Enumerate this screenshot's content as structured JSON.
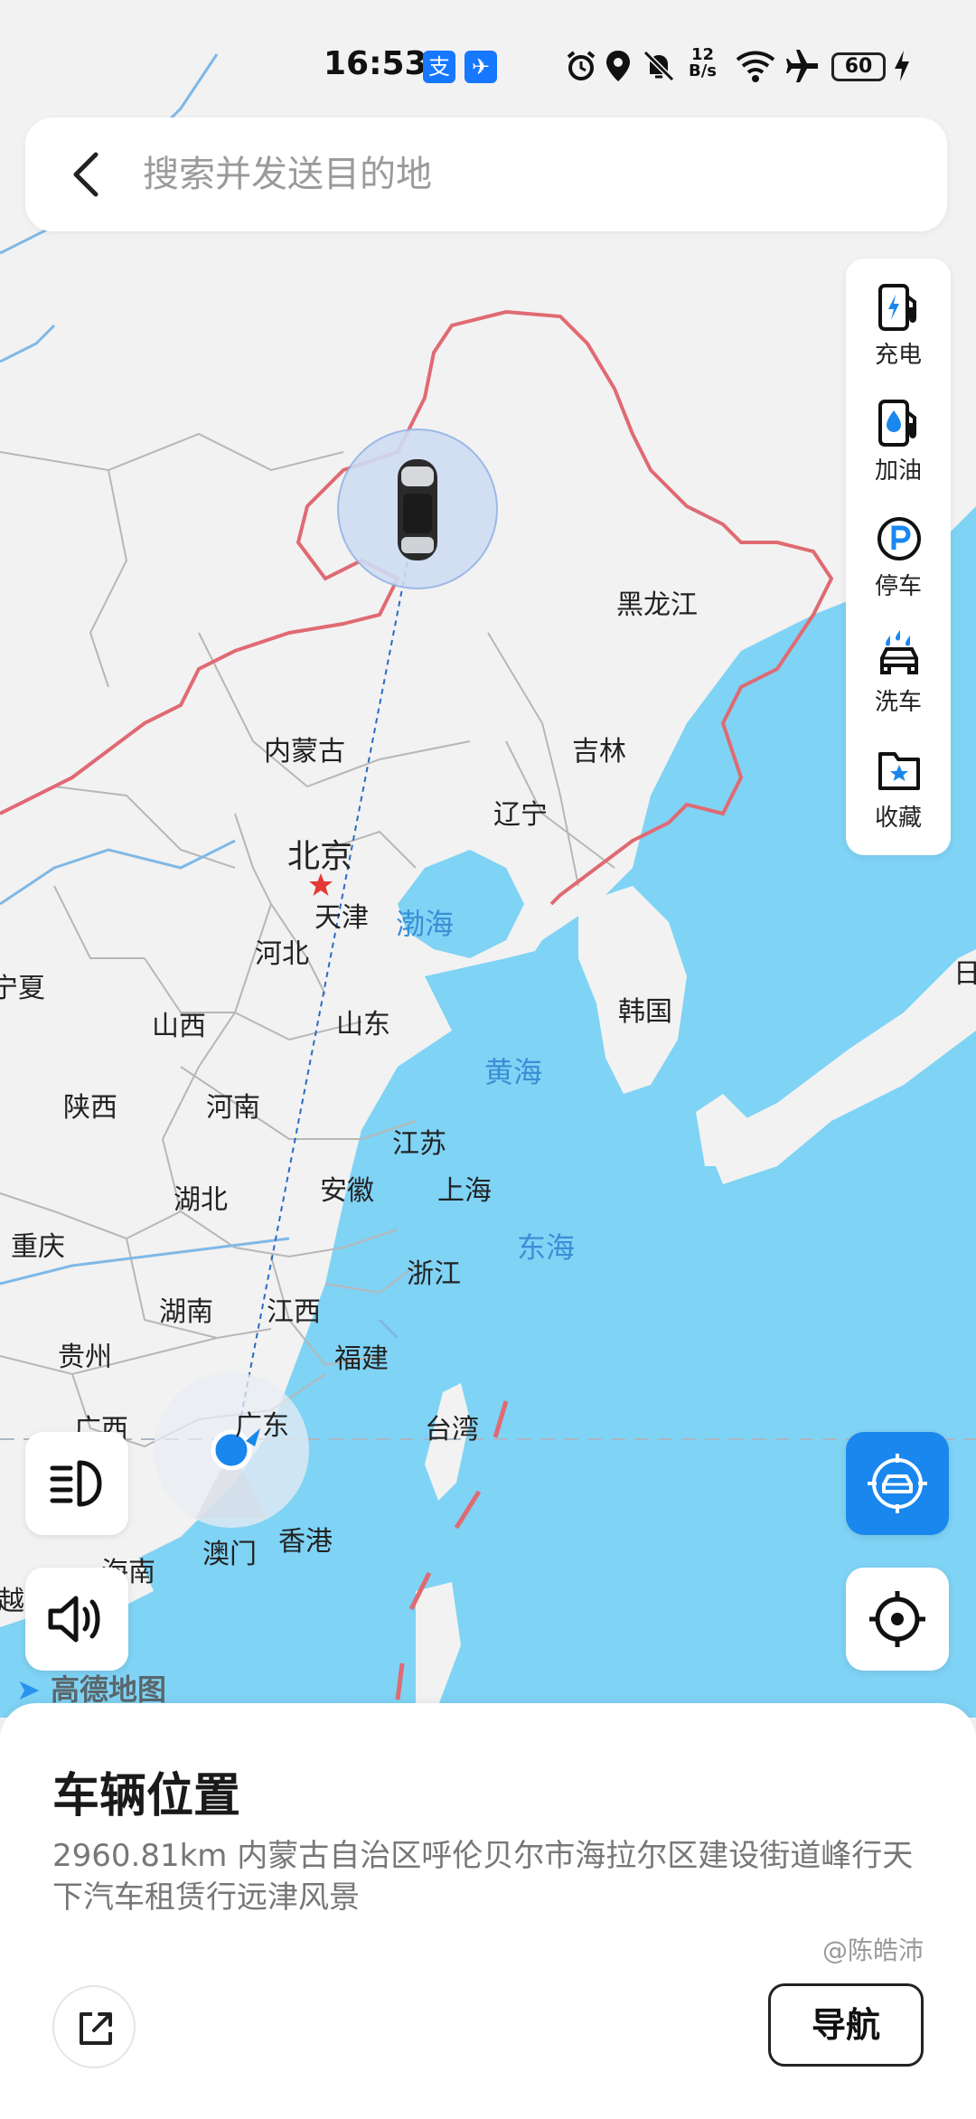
{
  "status_bar": {
    "time": "16:53",
    "app_icons": [
      "支",
      "✈"
    ],
    "network_speed_value": "12",
    "network_speed_unit": "B/s",
    "battery": "60",
    "icons": [
      "alarm-icon",
      "location-icon",
      "mute-icon",
      "wifi-icon",
      "airplane-icon",
      "charging-icon"
    ]
  },
  "search": {
    "placeholder": "搜索并发送目的地",
    "value": ""
  },
  "tools": [
    {
      "label": "充电",
      "icon": "charging-station-icon"
    },
    {
      "label": "加油",
      "icon": "fuel-icon"
    },
    {
      "label": "停车",
      "icon": "parking-icon"
    },
    {
      "label": "洗车",
      "icon": "car-wash-icon"
    },
    {
      "label": "收藏",
      "icon": "favorites-icon"
    }
  ],
  "map": {
    "labels": {
      "heilongjiang": "黑龙江",
      "neimenggu": "内蒙古",
      "jilin": "吉林",
      "liaoning": "辽宁",
      "beijing": "北京",
      "tianjin": "天津",
      "hebei": "河北",
      "ningxia": "宁夏",
      "shanxi": "山西",
      "shandong": "山东",
      "korea": "韩国",
      "shaanxi": "陕西",
      "henan": "河南",
      "jiangsu": "江苏",
      "anhui": "安徽",
      "shanghai": "上海",
      "hubei": "湖北",
      "chongqing": "重庆",
      "zhejiang": "浙江",
      "hunan": "湖南",
      "jiangxi": "江西",
      "guizhou": "贵州",
      "fujian": "福建",
      "guangxi": "广西",
      "guangdong": "广东",
      "taiwan": "台湾",
      "macau": "澳门",
      "hongkong": "香港",
      "hainan": "海南",
      "yue": "越",
      "japan": "日"
    },
    "seas": {
      "bohai": "渤海",
      "yellow_sea": "黄海",
      "east_sea": "东海"
    },
    "attribution": "高德地图"
  },
  "bottom_sheet": {
    "title": "车辆位置",
    "address": "2960.81km 内蒙古自治区呼伦贝尔市海拉尔区建设街道峰行天下汽车租赁行远津风景",
    "navigate_label": "导航"
  },
  "watermark": "@陈皓沛",
  "colors": {
    "accent": "#1a87ee",
    "border_red": "#e06a72",
    "sea": "#7fd3f5",
    "land": "#f2f2f2"
  }
}
